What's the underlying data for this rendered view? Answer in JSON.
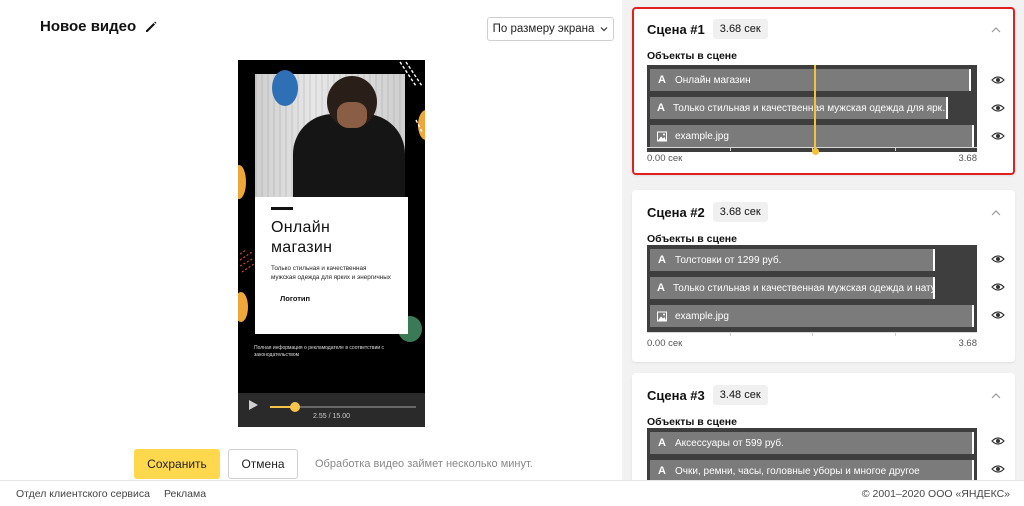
{
  "editor": {
    "title": "Новое видео",
    "fit_select": "По размеру экрана"
  },
  "preview": {
    "card_title": "Онлайн магазин",
    "card_subtitle": "Только стильная и качественная мужская одежда для ярких и энергичных",
    "card_logo": "Логотип",
    "legal_text": "Полная информация о рекламодателе в соответствии с законодательством",
    "time_readout": "2.55 / 15.00",
    "progress_fraction": 0.17,
    "colors": {
      "blue": "#2f6fb6",
      "orange": "#f0a73a",
      "green": "#3b7a57",
      "red": "#d9483b",
      "accent": "#f6c44a"
    }
  },
  "actions": {
    "save_label": "Сохранить",
    "cancel_label": "Отмена",
    "hint": "Обработка видео займет несколько минут."
  },
  "footer": {
    "support": "Отдел клиентского сервиса",
    "ads": "Реклама",
    "copyright": "© 2001–2020 ООО «ЯНДЕКС»"
  },
  "scenes": [
    {
      "title": "Сцена #1",
      "duration": "3.68 сек",
      "objects_label": "Объекты в сцене",
      "start": "0.00 сек",
      "end": "3.68",
      "playhead_fraction": 0.51,
      "layers": [
        {
          "type": "text",
          "icon": "text-icon",
          "label": "Онлайн магазин",
          "fill": 0.99
        },
        {
          "type": "text",
          "icon": "text-icon",
          "label": "Только стильная и качественная мужская одежда для ярк…",
          "fill": 0.92
        },
        {
          "type": "image",
          "icon": "image-icon",
          "label": "example.jpg",
          "fill": 1.0
        }
      ]
    },
    {
      "title": "Сцена #2",
      "duration": "3.68 сек",
      "objects_label": "Объекты в сцене",
      "start": "0.00 сек",
      "end": "3.68",
      "layers": [
        {
          "type": "text",
          "icon": "text-icon",
          "label": "Толстовки от 1299 руб.",
          "fill": 0.88
        },
        {
          "type": "text",
          "icon": "text-icon",
          "label": "Только стильная и качественная мужская одежда и натуральные ткани",
          "fill": 0.88
        },
        {
          "type": "image",
          "icon": "image-icon",
          "label": "example.jpg",
          "fill": 1.0
        }
      ]
    },
    {
      "title": "Сцена #3",
      "duration": "3.48 сек",
      "objects_label": "Объекты в сцене",
      "layers": [
        {
          "type": "text",
          "icon": "text-icon",
          "label": "Аксессуары от 599 руб.",
          "fill": 1.0
        },
        {
          "type": "text",
          "icon": "text-icon",
          "label": "Очки, ремни, часы, головные уборы и многое другое",
          "fill": 1.0
        }
      ]
    }
  ]
}
